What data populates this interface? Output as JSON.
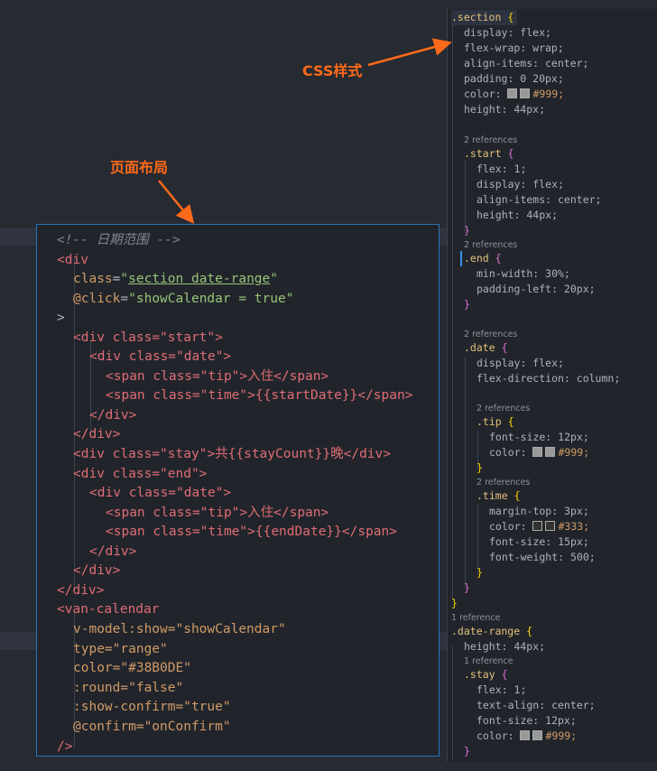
{
  "annotations": {
    "css_label": "CSS样式",
    "layout_label": "页面布局",
    "arrow_color": "#ff6a1a"
  },
  "html_code": {
    "comment": "<!-- 日期范围 -->",
    "div_open": "<div",
    "class_attr": "class",
    "class_val": "section date-range",
    "click_attr": "@click",
    "click_val": "showCalendar = true",
    "gt": ">",
    "start_open": "<div class=\"start\">",
    "date_open": "<div class=\"date\">",
    "tip_span_start": "<span class=\"tip\">入住</span>",
    "time_span_start": "<span class=\"time\">{{startDate}}</span>",
    "div_close": "</div>",
    "stay_div": "<div class=\"stay\">共{{stayCount}}晚</div>",
    "end_open": "<div class=\"end\">",
    "tip_span_end": "<span class=\"tip\">入住</span>",
    "time_span_end": "<span class=\"time\">{{endDate}}</span>",
    "van_open": "<van-calendar",
    "vmodel": "v-model:show=\"showCalendar\"",
    "type": "type=\"range\"",
    "color": "color=\"#38B0DE\"",
    "round": ":round=\"false\"",
    "show_confirm": ":show-confirm=\"true\"",
    "confirm": "@confirm=\"onConfirm\"",
    "self_close": "/>"
  },
  "css_code": {
    "section_sel": ".section",
    "open_brace": "{",
    "close_brace": "}",
    "display_flex": "display: flex;",
    "flex_wrap": "flex-wrap: wrap;",
    "align_center": "align-items: center;",
    "padding": "padding: 0 20px;",
    "color_999": "#999;",
    "color_333": "#333;",
    "color_prop": "color: ",
    "height44": "height: 44px;",
    "refs2": "2 references",
    "refs1": "1 reference",
    "start_sel": ".start",
    "flex1": "flex: 1;",
    "end_sel": ".end",
    "min_width": "min-width: 30%;",
    "padding_left": "padding-left: 20px;",
    "date_sel": ".date",
    "flex_dir": "flex-direction: column;",
    "tip_sel": ".tip",
    "font12": "font-size: 12px;",
    "time_sel": ".time",
    "margin_top": "margin-top: 3px;",
    "font15": "font-size: 15px;",
    "font_weight": "font-weight: 500;",
    "daterange_sel": ".date-range",
    "stay_sel": ".stay",
    "text_align": "text-align: center;"
  }
}
